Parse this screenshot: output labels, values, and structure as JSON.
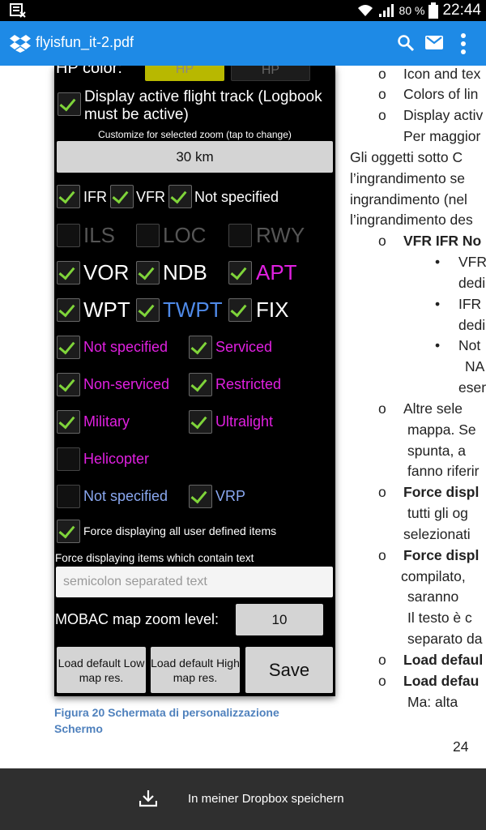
{
  "status": {
    "battery": "80 %",
    "time": "22:44"
  },
  "appbar": {
    "title": "flyisfun_it-2.pdf"
  },
  "screen": {
    "hp_label": "HP color:",
    "hp_btn1": "HP",
    "hp_btn2": "HP",
    "track_label": "Display active flight track (Logbook must be active)",
    "zoom_caption": "Customize for selected zoom (tap to change)",
    "zoom_value": "30 km",
    "row_ifr": [
      "IFR",
      "VFR",
      "Not specified"
    ],
    "row_ils": [
      "ILS",
      "LOC",
      "RWY"
    ],
    "row_vor": [
      "VOR",
      "NDB",
      "APT"
    ],
    "row_wpt": [
      "WPT",
      "TWPT",
      "FIX"
    ],
    "ap": [
      "Not specified",
      "Serviced",
      "Non-serviced",
      "Restricted",
      "Military",
      "Ultralight",
      "Helicopter"
    ],
    "last": [
      "Not specified",
      "VRP"
    ],
    "force_user": "Force displaying all user defined items",
    "force_text": "Force displaying items which contain text",
    "placeholder": "semicolon separated text",
    "mobac_label": "MOBAC map zoom level:",
    "mobac_value": "10",
    "btn_low": "Load default Low map res.",
    "btn_high": "Load default High map res.",
    "btn_save": "Save"
  },
  "caption": "Figura 20 Schermata di personalizzazione Schermo",
  "right": {
    "l1": "Icon and tex",
    "l2": "Colors of lin",
    "l3": "Display activ",
    "l4": "Per maggior",
    "p1": "Gli oggetti sotto C",
    "p2": "l’ingrandimento se",
    "p3": "ingrandimento (nel",
    "p4": "l’ingrandimento des",
    "vfr": "VFR IFR No",
    "s1a": "VFR",
    "s1b": "dedi",
    "s2a": "IFR",
    "s2b": "dedi",
    "s3a": "Not",
    "s3b": "NA",
    "s3c": "eser",
    "a1": "Altre sele",
    "a2": "mappa. Se",
    "a3": "spunta, a",
    "a4": "fanno riferir",
    "f1a": "Force displ",
    "f1b": "tutti gli og",
    "f1c": "selezionati",
    "f2a": "Force displ",
    "f2b": "compilato,",
    "f2c": "saranno",
    "f2d": "Il testo è c",
    "f2e": "separato da",
    "ld1": "Load defaul",
    "ld2": "Load defau",
    "ld3": "Ma:  alta"
  },
  "page_number": "24",
  "download": {
    "label": "In meiner Dropbox speichern"
  }
}
